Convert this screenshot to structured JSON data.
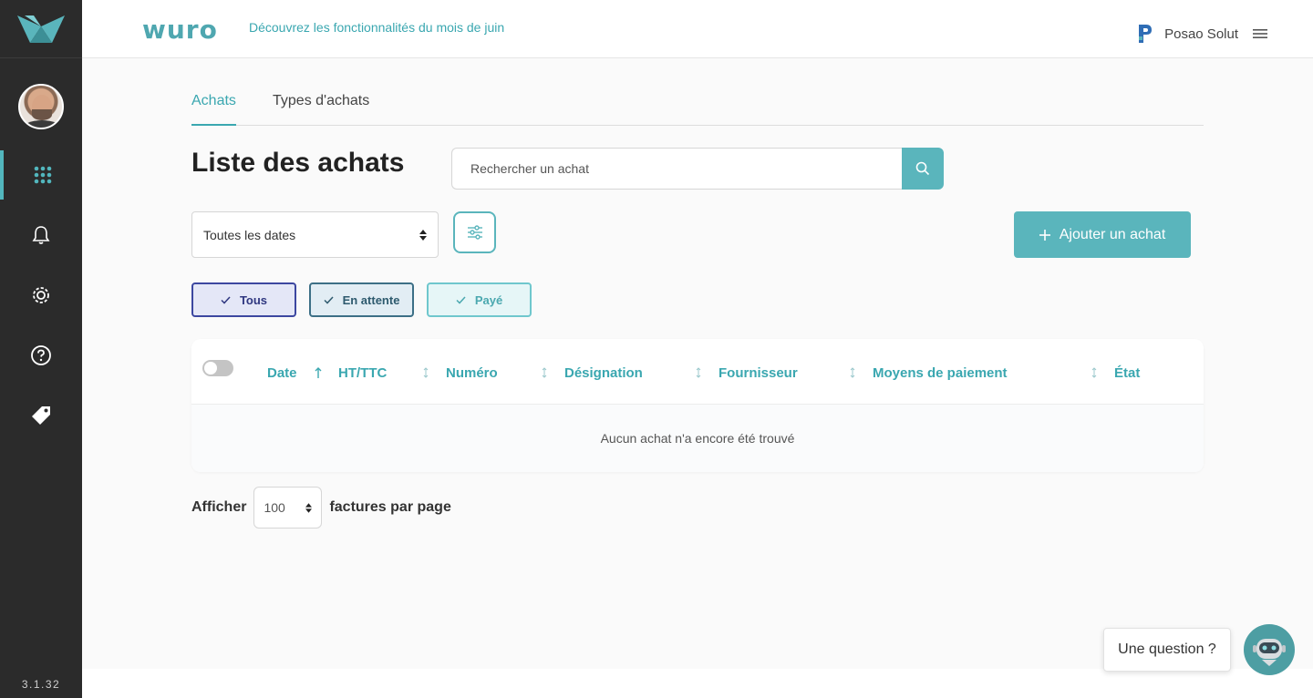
{
  "app": {
    "brand": "wuro",
    "announcement": "Découvrez les fonctionnalités du mois de juin",
    "organization": "Posao Solut",
    "version": "3.1.32"
  },
  "sidebar": {
    "items": [
      {
        "icon": "grid-icon",
        "active": true
      },
      {
        "icon": "bell-icon",
        "active": false
      },
      {
        "icon": "gear-icon",
        "active": false
      },
      {
        "icon": "help-icon",
        "active": false
      },
      {
        "icon": "tag-icon",
        "active": false
      }
    ]
  },
  "tabs": [
    {
      "label": "Achats",
      "active": true
    },
    {
      "label": "Types d'achats",
      "active": false
    }
  ],
  "page": {
    "title": "Liste des achats",
    "search_placeholder": "Rechercher un achat",
    "date_filter": "Toutes les dates",
    "add_button": "Ajouter un achat"
  },
  "status_filters": [
    {
      "label": "Tous"
    },
    {
      "label": "En attente"
    },
    {
      "label": "Payé"
    }
  ],
  "table": {
    "columns": [
      "Date",
      "HT/TTC",
      "Numéro",
      "Désignation",
      "Fournisseur",
      "Moyens de paiement",
      "État"
    ],
    "empty_message": "Aucun achat n'a encore été trouvé"
  },
  "pagination": {
    "show_label": "Afficher",
    "per_page_value": "100",
    "per_page_suffix": "factures par page"
  },
  "chat": {
    "prompt": "Une question ?"
  },
  "colors": {
    "accent": "#5ab5bc",
    "sidebar": "#2b2b2b"
  }
}
